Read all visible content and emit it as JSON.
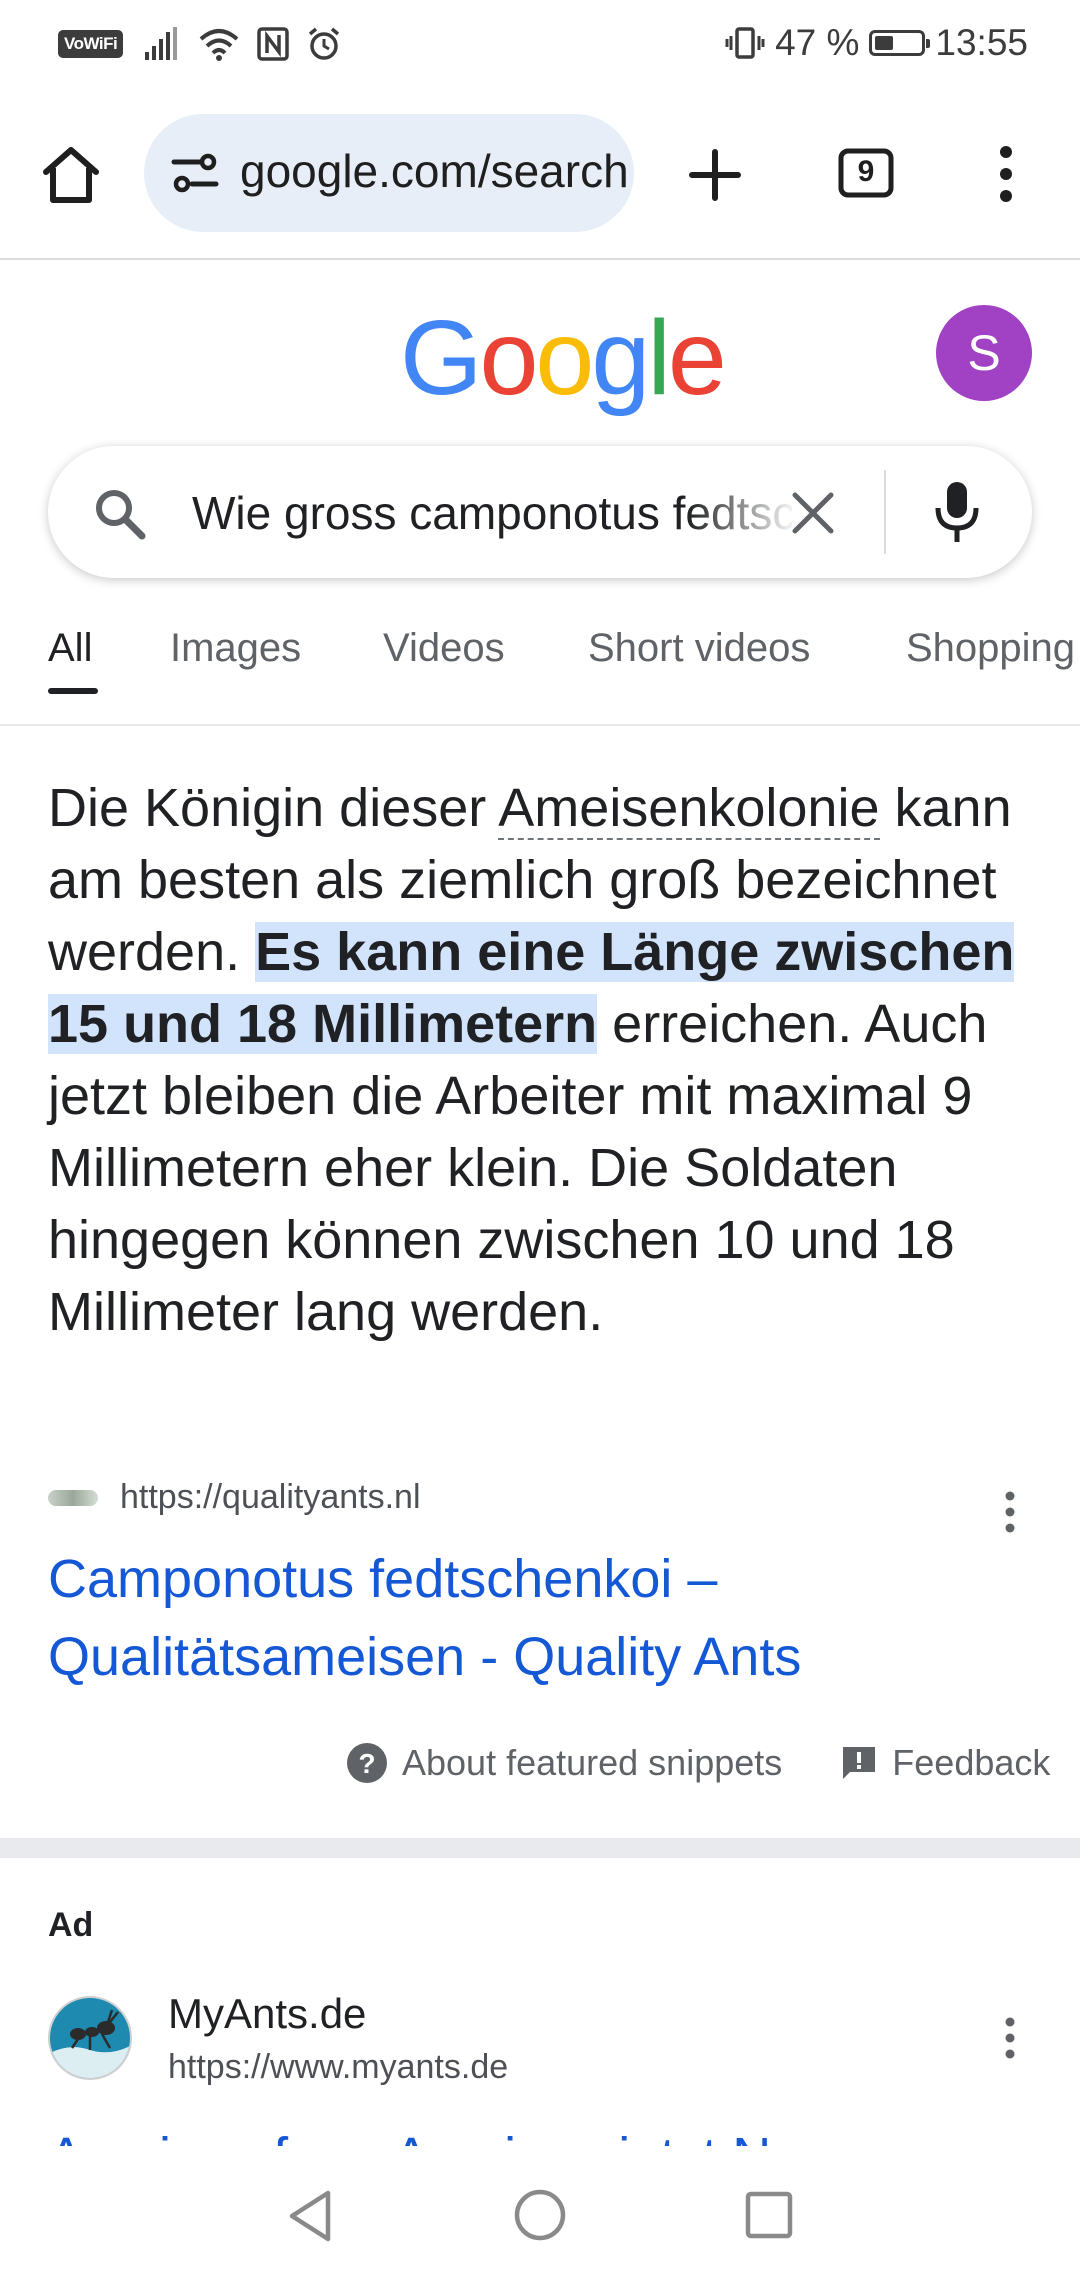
{
  "status_bar": {
    "vowifi": "VoWiFi",
    "battery_percent_text": "47 %",
    "battery_level": 0.47,
    "time": "13:55"
  },
  "toolbar": {
    "url": "google.com/search",
    "tab_count": "9"
  },
  "google": {
    "logo_letters": [
      {
        "char": "G",
        "color": "#4285F4"
      },
      {
        "char": "o",
        "color": "#EA4335"
      },
      {
        "char": "o",
        "color": "#FBBC05"
      },
      {
        "char": "g",
        "color": "#4285F4"
      },
      {
        "char": "l",
        "color": "#34A853"
      },
      {
        "char": "e",
        "color": "#EA4335"
      }
    ],
    "avatar_letter": "S"
  },
  "search": {
    "query": "Wie gross camponotus fedtschenkoi"
  },
  "tabs": [
    {
      "label": "All",
      "active": true
    },
    {
      "label": "Images",
      "active": false
    },
    {
      "label": "Videos",
      "active": false
    },
    {
      "label": "Short videos",
      "active": false
    },
    {
      "label": "Shopping",
      "active": false
    }
  ],
  "snippet": {
    "part1": "Die Königin dieser ",
    "linked_term": "Ameisenkolonie",
    "part2": " kann am besten als ziemlich groß bezeichnet werden. ",
    "highlight": "Es kann eine Länge zwischen 15 und 18 Millimetern",
    "part3": " erreichen. Auch jetzt bleiben die Arbeiter mit maximal 9 Millimetern eher klein. Die Soldaten hingegen können zwischen 10 und 18 Millimeter lang werden."
  },
  "source": {
    "url": "https://qualityants.nl",
    "title": "Camponotus fedtschenkoi – Qualitätsameisen - Quality Ants"
  },
  "about": {
    "about_label": "About featured snippets",
    "feedback_label": "Feedback"
  },
  "ad": {
    "label": "Ad",
    "name": "MyAnts.de",
    "url": "https://www.myants.de",
    "title_peek": "Ameisen farm Ameisen jetzt N"
  }
}
